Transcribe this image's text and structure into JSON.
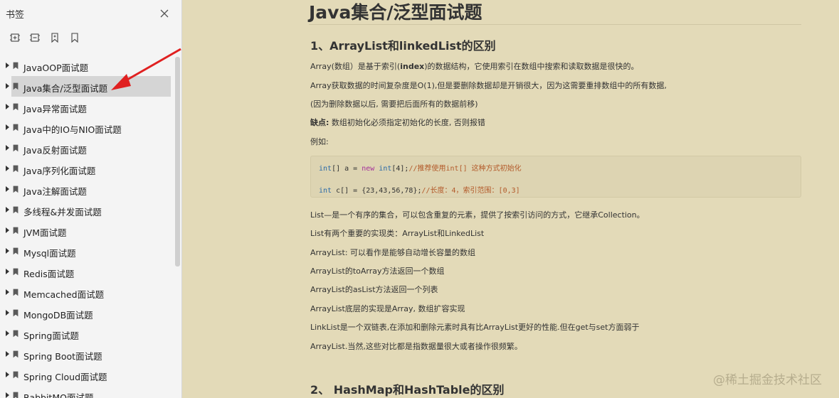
{
  "sidebar": {
    "title": "书签",
    "toolbar": [
      {
        "icon": "expand-all-icon"
      },
      {
        "icon": "collapse-all-icon"
      },
      {
        "icon": "add-bookmark-icon"
      },
      {
        "icon": "bookmark-icon"
      }
    ],
    "items": [
      {
        "label": "JavaOOP面试题",
        "selected": false
      },
      {
        "label": "Java集合/泛型面试题",
        "selected": true
      },
      {
        "label": "Java异常面试题",
        "selected": false
      },
      {
        "label": "Java中的IO与NIO面试题",
        "selected": false
      },
      {
        "label": "Java反射面试题",
        "selected": false
      },
      {
        "label": "Java序列化面试题",
        "selected": false
      },
      {
        "label": "Java注解面试题",
        "selected": false
      },
      {
        "label": "多线程&并发面试题",
        "selected": false
      },
      {
        "label": "JVM面试题",
        "selected": false
      },
      {
        "label": "Mysql面试题",
        "selected": false
      },
      {
        "label": "Redis面试题",
        "selected": false
      },
      {
        "label": "Memcached面试题",
        "selected": false
      },
      {
        "label": "MongoDB面试题",
        "selected": false
      },
      {
        "label": "Spring面试题",
        "selected": false
      },
      {
        "label": "Spring Boot面试题",
        "selected": false
      },
      {
        "label": "Spring Cloud面试题",
        "selected": false
      },
      {
        "label": "RabbitMQ面试题",
        "selected": false
      }
    ]
  },
  "colors": {
    "content_bg": "#e3dab8",
    "sidebar_bg": "#f4f4f4",
    "selected_bg": "#d5d5d5",
    "annotation_arrow": "#e02020"
  },
  "doc": {
    "title": "Java集合/泛型面试题",
    "section1": {
      "heading": "1、ArrayList和linkedList的区别",
      "p1_pre": "Array(数组）是基于索引(",
      "p1_bold": "index",
      "p1_post": ")的数据结构，它使用索引在数组中搜索和读取数据是很快的。",
      "p2": "Array获取数据的时间复杂度是O(1),但是要删除数据却是开销很大，因为这需要重排数组中的所有数据,",
      "p3": "(因为删除数据以后, 需要把后面所有的数据前移)",
      "p4_bold": "缺点:",
      "p4_rest": " 数组初始化必须指定初始化的长度, 否则报错",
      "p5": "例如:",
      "code": {
        "l1_type": "int",
        "l1_mid1": "[] a = ",
        "l1_kw": "new",
        "l1_type2": " int",
        "l1_mid2": "[4];",
        "l1_cmt": "//推荐使用int[] 这种方式初始化",
        "l2_type": "int",
        "l2_mid": " c[] = {23,43,56,78};",
        "l2_cmt": "//长度：4，索引范围：[0,3]"
      },
      "p6": "List—是一个有序的集合，可以包含重复的元素，提供了按索引访问的方式，它继承Collection。",
      "p7": "List有两个重要的实现类：ArrayList和LinkedList",
      "p8": "ArrayList: 可以看作是能够自动增长容量的数组",
      "p9": "ArrayList的toArray方法返回一个数组",
      "p10": "ArrayList的asList方法返回一个列表",
      "p11": "ArrayList底层的实现是Array, 数组扩容实现",
      "p12": "LinkList是一个双链表,在添加和删除元素时具有比ArrayList更好的性能.但在get与set方面弱于",
      "p13": "ArrayList.当然,这些对比都是指数据量很大或者操作很频繁。"
    },
    "section2": {
      "heading": "2、 HashMap和HashTable的区别"
    }
  },
  "watermark": "@稀土掘金技术社区"
}
